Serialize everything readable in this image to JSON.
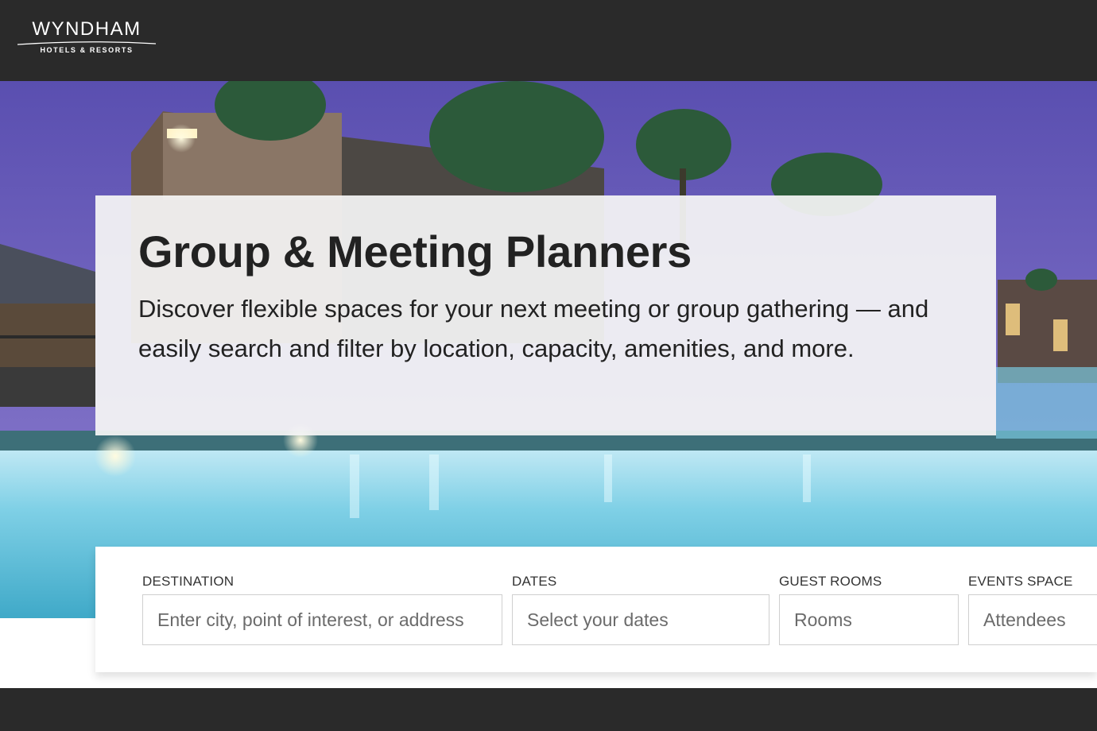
{
  "brand": {
    "name": "WYNDHAM",
    "tagline": "HOTELS & RESORTS"
  },
  "hero": {
    "title": "Group & Meeting Planners",
    "description": "Discover flexible spaces for your next meeting or group gathering — and easily search and filter by location, capacity, amenities, and more."
  },
  "search": {
    "destination": {
      "label": "DESTINATION",
      "placeholder": "Enter city, point of interest, or address"
    },
    "dates": {
      "label": "DATES",
      "placeholder": "Select your dates"
    },
    "guest_rooms": {
      "label": "GUEST ROOMS",
      "placeholder": "Rooms"
    },
    "events_space": {
      "label": "EVENTS SPACE",
      "placeholder": "Attendees"
    }
  },
  "colors": {
    "header_bg": "#2a2a2a",
    "card_bg": "#f5f5f5",
    "text_dark": "#222222"
  }
}
